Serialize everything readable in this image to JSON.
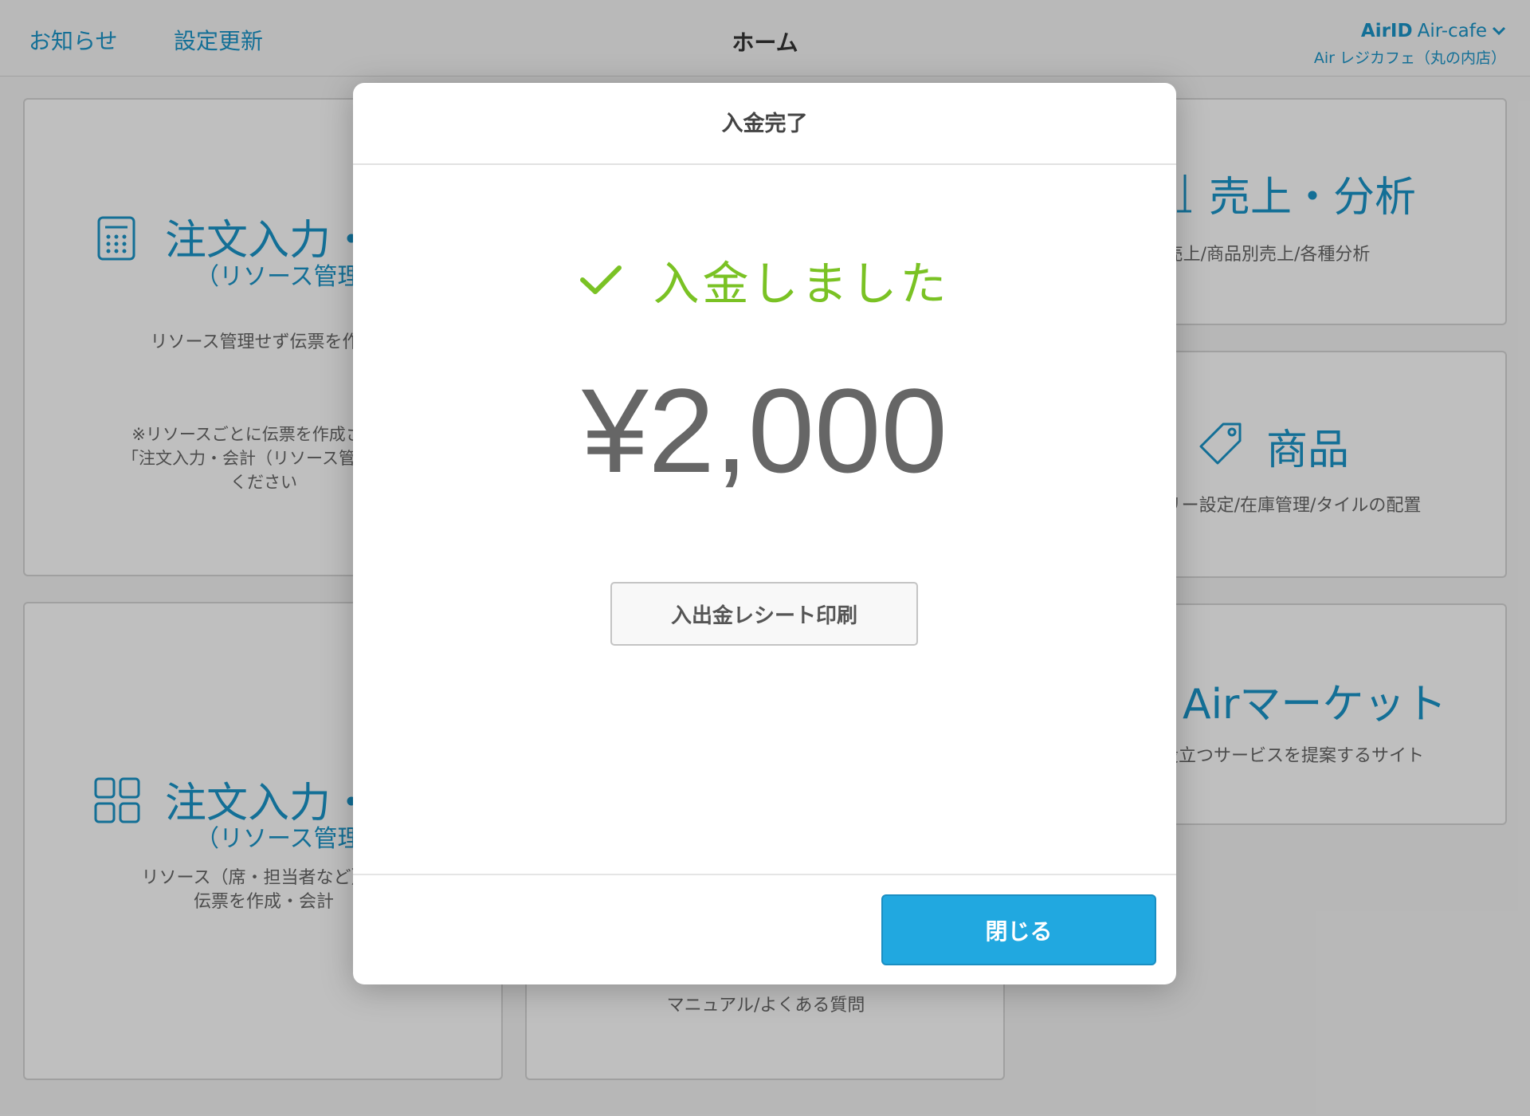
{
  "header": {
    "notice": "お知らせ",
    "settings_update": "設定更新",
    "title": "ホーム",
    "account_id_prefix": "AirID",
    "account_id": "Air-cafe",
    "store_name": "Air レジカフェ（丸の内店）"
  },
  "cards": {
    "order_simple": {
      "title": "注文入力・",
      "subtitle": "（リソース管理",
      "desc": "リソース管理せず伝票を作成",
      "note_line1": "※リソースごとに伝票を作成される",
      "note_line2": "「注文入力・会計（リソース管理あり",
      "note_line3": "ください"
    },
    "order_resource": {
      "title": "注文入力・",
      "subtitle": "（リソース管理",
      "desc_line1": "リソース（席・担当者など）ご",
      "desc_line2": "伝票を作成・会計"
    },
    "sales": {
      "title": "売上・分析",
      "desc": "売上/商品別売上/各種分析"
    },
    "products": {
      "title": "商品",
      "desc": "ゴリー設定/在庫管理/タイルの配置"
    },
    "market": {
      "title": "Airマーケット",
      "desc": "に役立つサービスを提案するサイト"
    },
    "help": {
      "desc": "マニュアル/よくある質問"
    }
  },
  "modal": {
    "title": "入金完了",
    "success_message": "入金しました",
    "amount": "¥2,000",
    "print_button": "入出金レシート印刷",
    "close_button": "閉じる"
  },
  "colors": {
    "accent": "#1a95c9",
    "success": "#7ac224",
    "primary_button": "#21a8e0"
  },
  "icons": {
    "checkmark": "check-icon",
    "calculator": "calculator-icon",
    "grid": "grid-icon",
    "tag": "tag-icon",
    "chart": "chart-icon",
    "chevron": "chevron-down-icon"
  }
}
